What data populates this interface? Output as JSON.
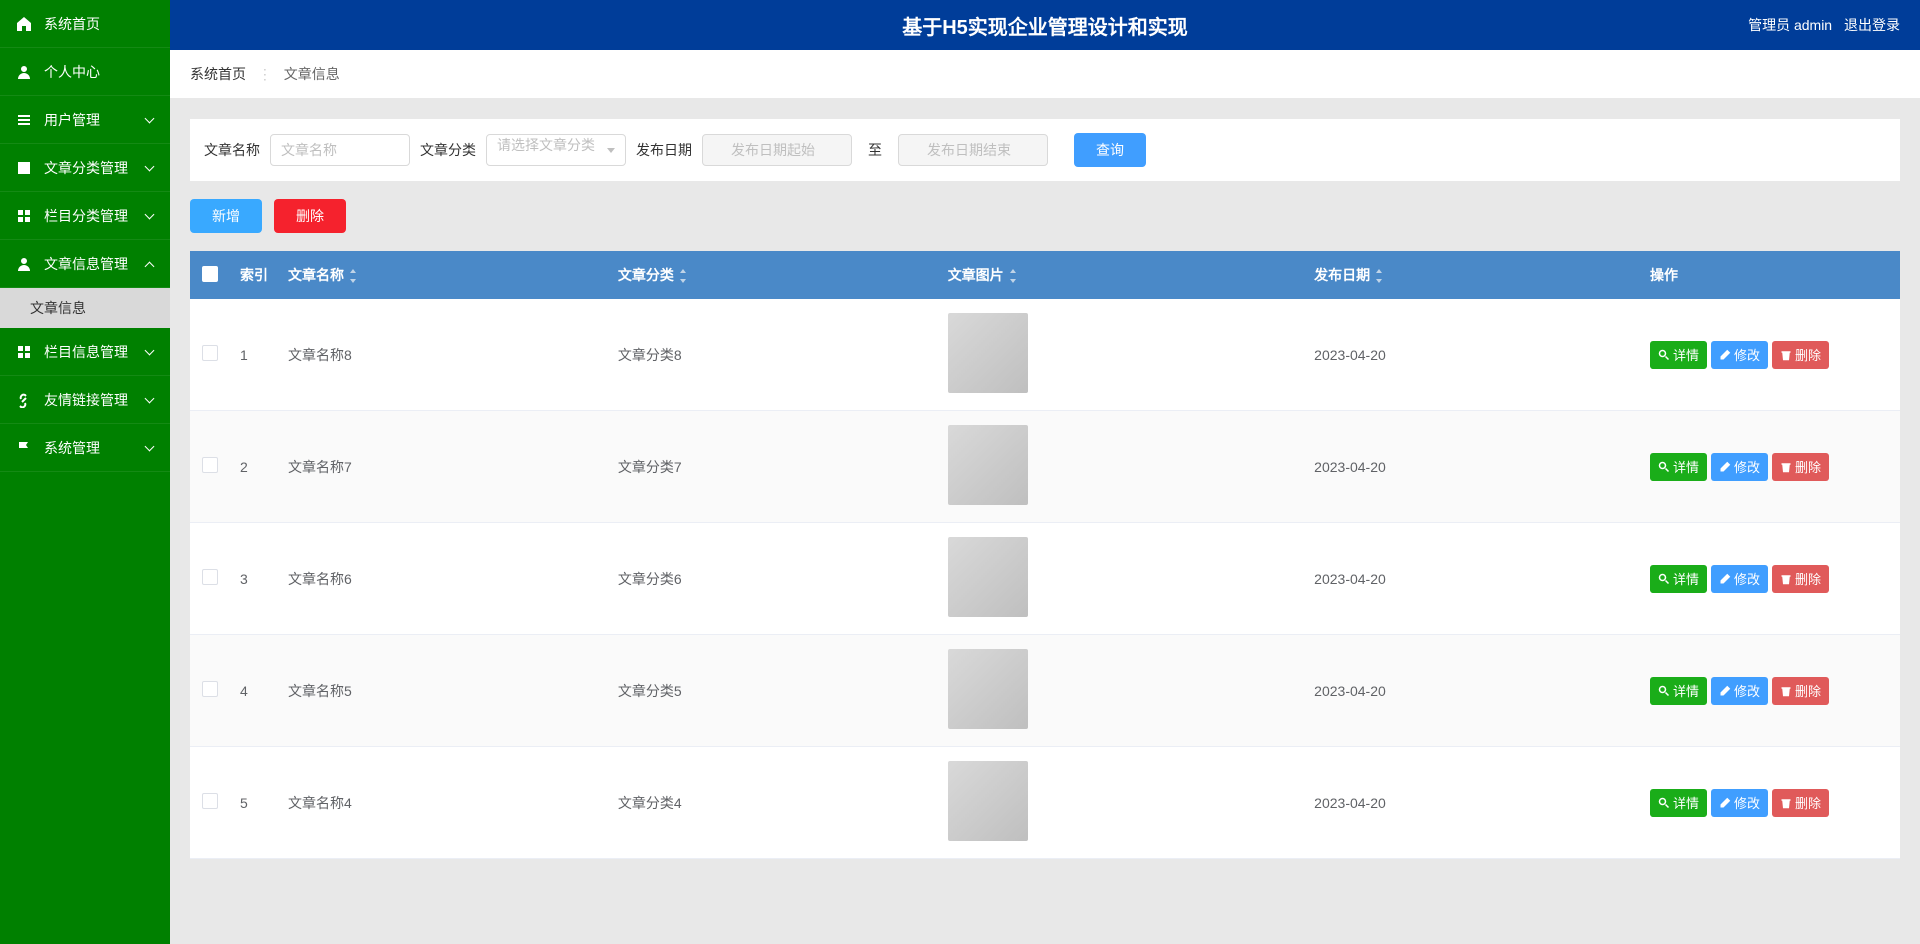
{
  "header": {
    "title": "基于H5实现企业管理设计和实现",
    "admin_label": "管理员 admin",
    "logout": "退出登录"
  },
  "sidebar": {
    "items": [
      {
        "label": "系统首页",
        "icon": "home"
      },
      {
        "label": "个人中心",
        "icon": "user"
      },
      {
        "label": "用户管理",
        "icon": "list",
        "expand": true
      },
      {
        "label": "文章分类管理",
        "icon": "box",
        "expand": true
      },
      {
        "label": "栏目分类管理",
        "icon": "grid",
        "expand": true
      },
      {
        "label": "文章信息管理",
        "icon": "user",
        "expand": true,
        "open": true,
        "children": [
          {
            "label": "文章信息"
          }
        ]
      },
      {
        "label": "栏目信息管理",
        "icon": "grid",
        "expand": true
      },
      {
        "label": "友情链接管理",
        "icon": "link",
        "expand": true
      },
      {
        "label": "系统管理",
        "icon": "flag",
        "expand": true
      }
    ]
  },
  "breadcrumb": {
    "home": "系统首页",
    "current": "文章信息"
  },
  "filters": {
    "name_label": "文章名称",
    "name_placeholder": "文章名称",
    "cat_label": "文章分类",
    "cat_placeholder": "请选择文章分类",
    "date_label": "发布日期",
    "date_start_placeholder": "发布日期起始",
    "date_end_placeholder": "发布日期结束",
    "date_sep": "至",
    "search_btn": "查询"
  },
  "actions": {
    "add": "新增",
    "delete": "删除"
  },
  "table": {
    "headers": {
      "index": "索引",
      "name": "文章名称",
      "category": "文章分类",
      "image": "文章图片",
      "date": "发布日期",
      "ops": "操作"
    },
    "row_btns": {
      "view": "详情",
      "edit": "修改",
      "del": "删除"
    },
    "rows": [
      {
        "idx": "1",
        "name": "文章名称8",
        "cat": "文章分类8",
        "date": "2023-04-20"
      },
      {
        "idx": "2",
        "name": "文章名称7",
        "cat": "文章分类7",
        "date": "2023-04-20"
      },
      {
        "idx": "3",
        "name": "文章名称6",
        "cat": "文章分类6",
        "date": "2023-04-20"
      },
      {
        "idx": "4",
        "name": "文章名称5",
        "cat": "文章分类5",
        "date": "2023-04-20"
      },
      {
        "idx": "5",
        "name": "文章名称4",
        "cat": "文章分类4",
        "date": "2023-04-20"
      }
    ]
  }
}
